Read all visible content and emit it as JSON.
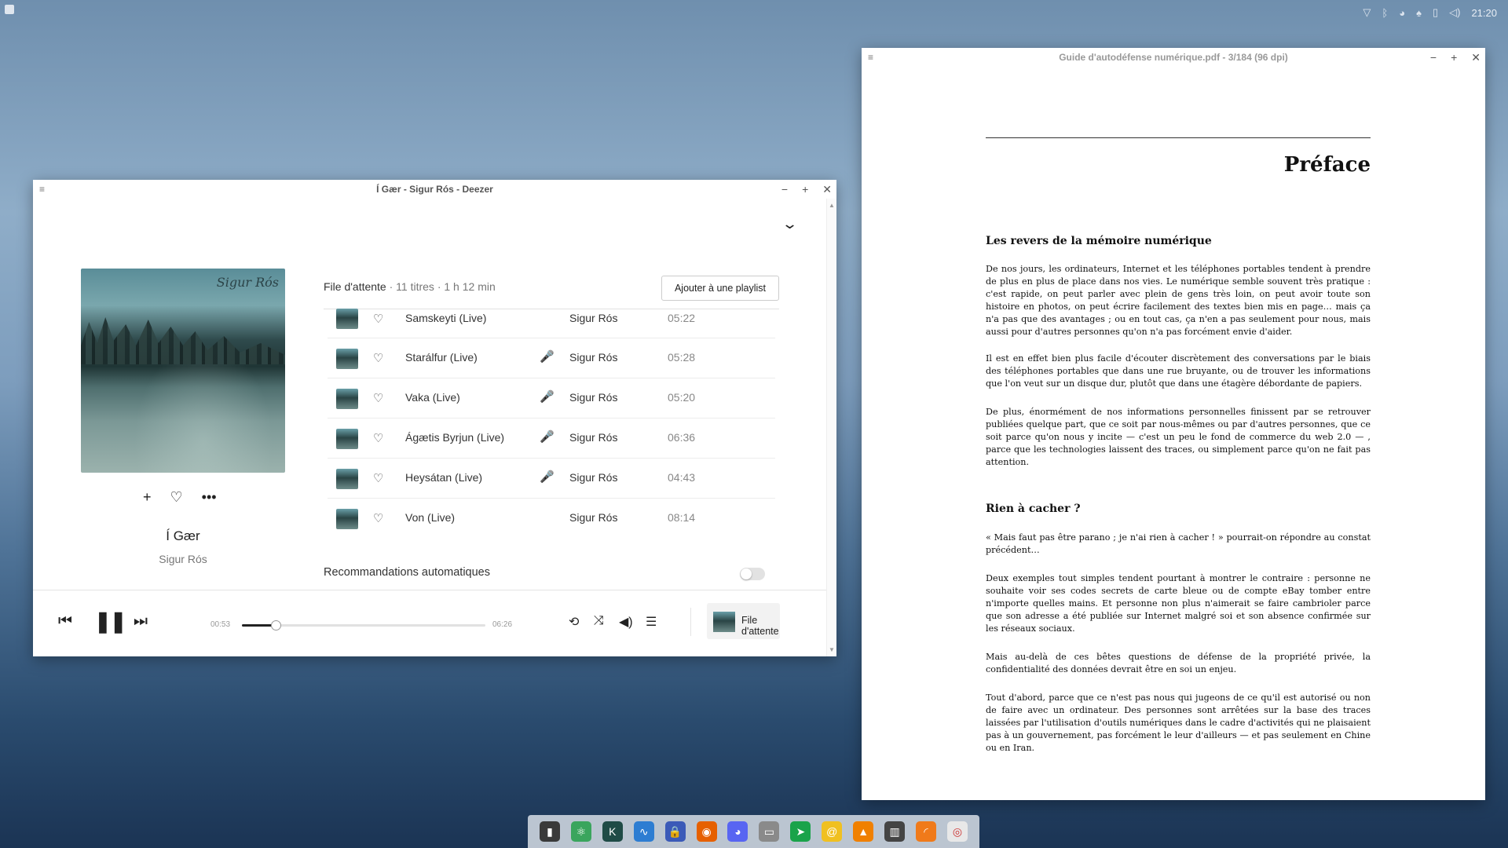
{
  "topbar": {
    "clock": "21:20"
  },
  "deezer": {
    "title": "Í Gær - Sigur Rós - Deezer",
    "album": {
      "title": "Í Gær",
      "artist": "Sigur Rós",
      "cover_text": "Sigur Rós"
    },
    "queue": {
      "label": "File d'attente",
      "meta": " · 11 titres · 1 h 12 min",
      "add_playlist": "Ajouter à une playlist",
      "tracks": [
        {
          "title": "Samskeyti (Live)",
          "artist": "Sigur Rós",
          "duration": "05:22",
          "lyrics": false
        },
        {
          "title": "Starálfur (Live)",
          "artist": "Sigur Rós",
          "duration": "05:28",
          "lyrics": true
        },
        {
          "title": "Vaka (Live)",
          "artist": "Sigur Rós",
          "duration": "05:20",
          "lyrics": true
        },
        {
          "title": "Ágætis Byrjun (Live)",
          "artist": "Sigur Rós",
          "duration": "06:36",
          "lyrics": true
        },
        {
          "title": "Heysátan (Live)",
          "artist": "Sigur Rós",
          "duration": "04:43",
          "lyrics": true
        },
        {
          "title": "Von (Live)",
          "artist": "Sigur Rós",
          "duration": "08:14",
          "lyrics": false
        }
      ]
    },
    "recommendations": {
      "label": "Recommandations automatiques",
      "enabled": false
    },
    "player": {
      "current_time": "00:53",
      "total_time": "06:26",
      "progress": 0.14,
      "queue_button": "File d'attente"
    }
  },
  "pdf": {
    "title": "Guide d'autodéfense numérique.pdf - 3/184 (96 dpi)",
    "chapter": "Préface",
    "section1": "Les revers de la mémoire numérique",
    "section2": "Rien à cacher ?",
    "paragraphs": [
      "De nos jours, les ordinateurs, Internet et les téléphones portables tendent à prendre de plus en plus de place dans nos vies. Le numérique semble souvent très pratique : c'est rapide, on peut parler avec plein de gens très loin, on peut avoir toute son histoire en photos, on peut écrire facilement des textes bien mis en page… mais ça n'a pas que des avantages ; ou en tout cas, ça n'en a pas seulement pour nous, mais aussi pour d'autres personnes qu'on n'a pas forcément envie d'aider.",
      "Il est en effet bien plus facile d'écouter discrètement des conversations par le biais des téléphones portables que dans une rue bruyante, ou de trouver les informations que l'on veut sur un disque dur, plutôt que dans une étagère débordante de papiers.",
      "De plus, énormément de nos informations personnelles finissent par se retrouver publiées quelque part, que ce soit par nous-mêmes ou par d'autres personnes, que ce soit parce qu'on nous y incite — c'est un peu le fond de commerce du web 2.0 — , parce que les technologies laissent des traces, ou simplement parce qu'on ne fait pas attention.",
      "« Mais faut pas être parano ; je n'ai rien à cacher ! » pourrait-on répondre au constat précédent…",
      "Deux exemples tout simples tendent pourtant à montrer le contraire : personne ne souhaite voir ses codes secrets de carte bleue ou de compte eBay tomber entre n'importe quelles mains. Et personne non plus n'aimerait se faire cambrioler parce que son adresse a été publiée sur Internet malgré soi et son absence confirmée sur les réseaux sociaux.",
      "Mais au-delà de ces bêtes questions de défense de la propriété privée, la confidentialité des données devrait être en soi un enjeu.",
      "Tout d'abord, parce que ce n'est pas nous qui jugeons de ce qu'il est autorisé ou non de faire avec un ordinateur. Des personnes sont arrêtées sur la base des traces laissées par l'utilisation d'outils numériques dans le cadre d'activités qui ne plaisaient pas à un gouvernement, pas forcément le leur d'ailleurs — et pas seulement en Chine ou en Iran."
    ]
  },
  "dock": {
    "apps": [
      {
        "name": "terminal-icon",
        "color": "#3a3a3a",
        "glyph": "▮"
      },
      {
        "name": "atom-icon",
        "color": "#3aa55d",
        "glyph": "⚛"
      },
      {
        "name": "code-editor-icon",
        "color": "#1f4b46",
        "glyph": "K"
      },
      {
        "name": "audio-icon",
        "color": "#2d7dd2",
        "glyph": "∿"
      },
      {
        "name": "lock-icon",
        "color": "#3b5ab8",
        "glyph": "🔒"
      },
      {
        "name": "firefox-icon",
        "color": "#e66000",
        "glyph": "◉"
      },
      {
        "name": "discord-icon",
        "color": "#5865f2",
        "glyph": "◕"
      },
      {
        "name": "files-icon",
        "color": "#8a8a8a",
        "glyph": "▭"
      },
      {
        "name": "telegram-icon",
        "color": "#1aa34a",
        "glyph": "➤"
      },
      {
        "name": "mail-icon",
        "color": "#f0c020",
        "glyph": "@"
      },
      {
        "name": "vlc-icon",
        "color": "#f08000",
        "glyph": "▲"
      },
      {
        "name": "equalizer-icon",
        "color": "#444444",
        "glyph": "▥"
      },
      {
        "name": "rss-icon",
        "color": "#f07a1a",
        "glyph": "◜"
      },
      {
        "name": "document-viewer-icon",
        "color": "#e8e8e8",
        "glyph": "◎"
      }
    ]
  }
}
